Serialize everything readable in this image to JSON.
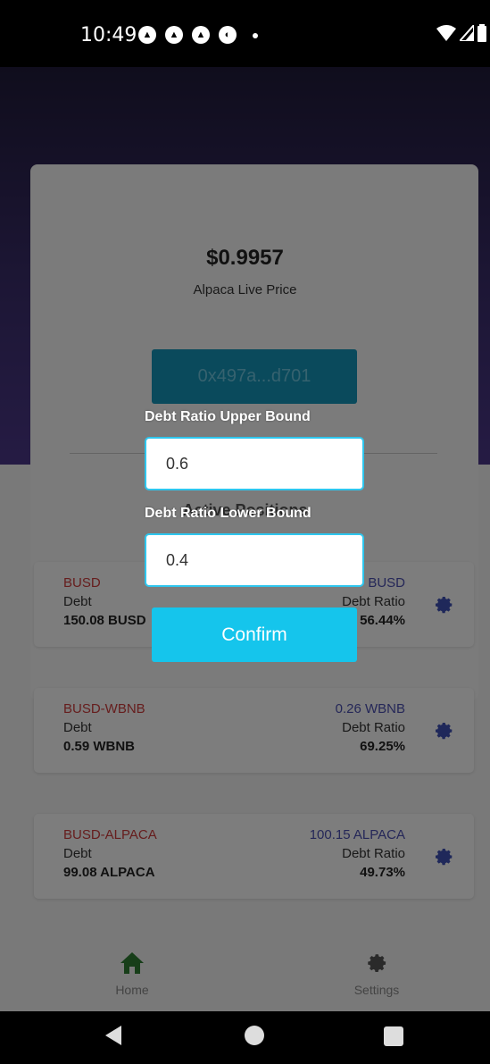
{
  "status_bar": {
    "time": "10:49"
  },
  "price_card": {
    "price": "$0.9957",
    "price_label": "Alpaca Live Price",
    "wallet_address": "0x497a...d701"
  },
  "positions": {
    "title": "Active Positions",
    "items": [
      {
        "name": "BUSD",
        "debt_label": "Debt",
        "debt_value": "150.08 BUSD",
        "right_top": "BUSD",
        "ratio_label": "Debt Ratio",
        "ratio_value": "56.44%"
      },
      {
        "name": "BUSD-WBNB",
        "debt_label": "Debt",
        "debt_value": "0.59 WBNB",
        "right_top": "0.26 WBNB",
        "ratio_label": "Debt Ratio",
        "ratio_value": "69.25%"
      },
      {
        "name": "BUSD-ALPACA",
        "debt_label": "Debt",
        "debt_value": "99.08 ALPACA",
        "right_top": "100.15 ALPACA",
        "ratio_label": "Debt Ratio",
        "ratio_value": "49.73%"
      }
    ]
  },
  "modal": {
    "upper_label": "Debt Ratio Upper Bound",
    "upper_value": "0.6",
    "lower_label": "Debt Ratio Lower Bound",
    "lower_value": "0.4",
    "confirm_label": "Confirm"
  },
  "bottom_nav": {
    "home_label": "Home",
    "settings_label": "Settings"
  },
  "colors": {
    "accent": "#15c5ec",
    "wallet_button": "#1494b8",
    "home_active": "#2e7d32",
    "header_gradient_end": "#4b3788"
  }
}
